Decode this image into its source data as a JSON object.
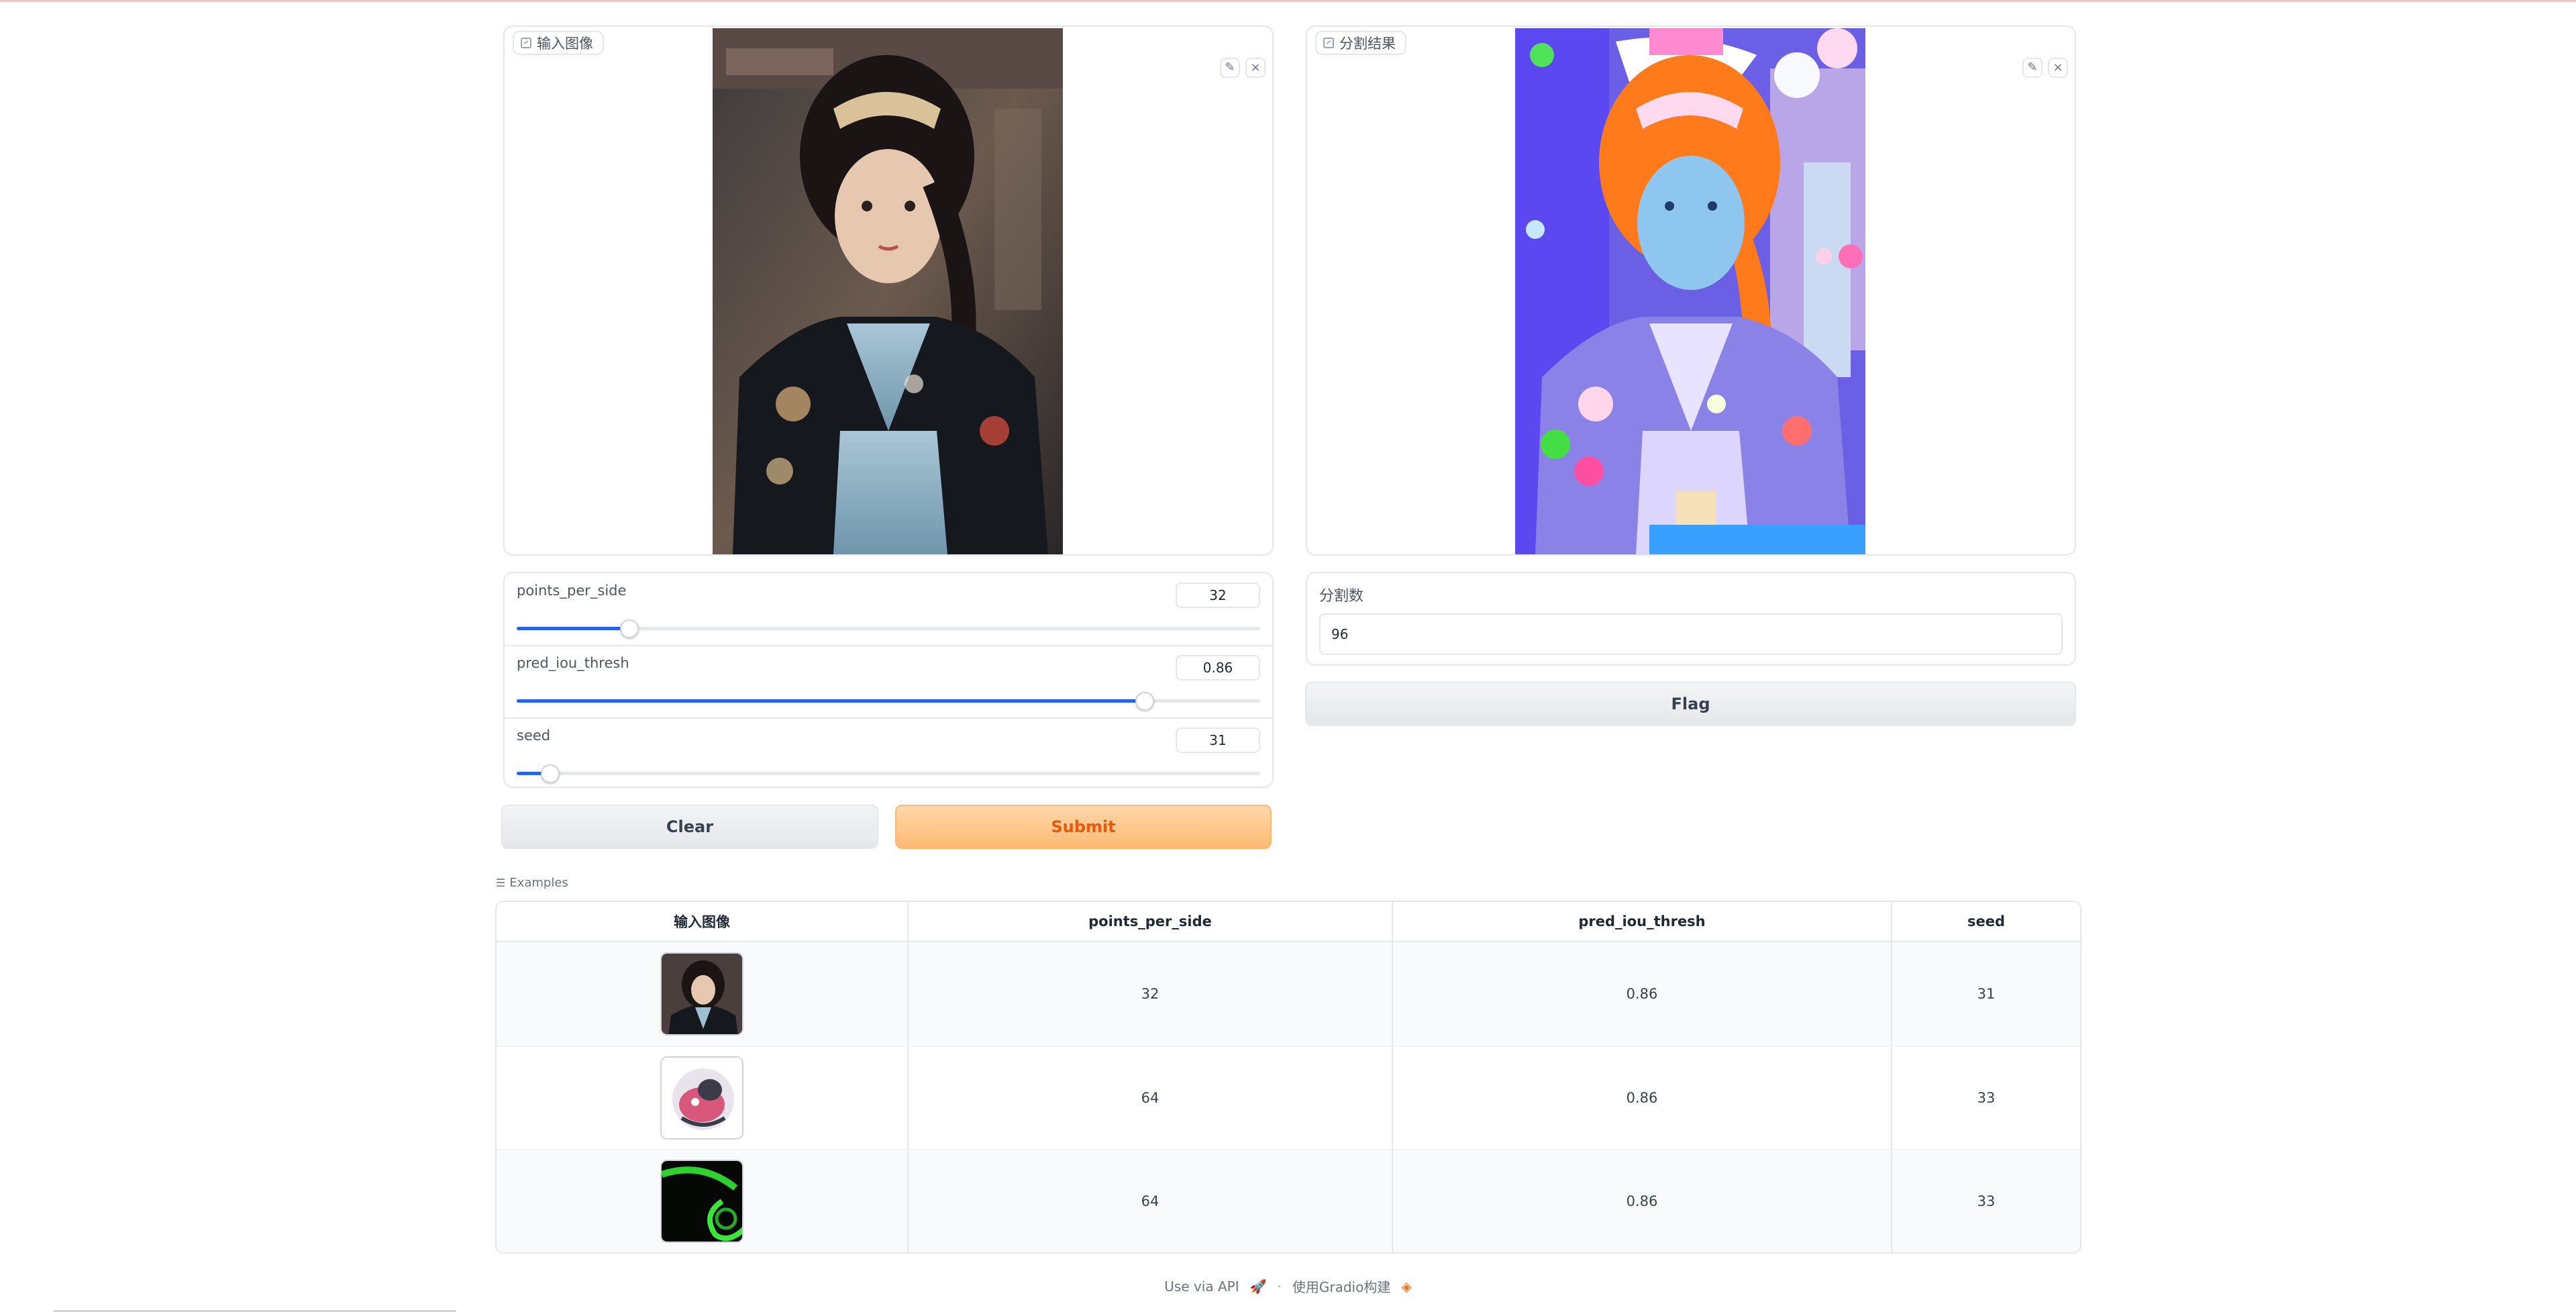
{
  "input_image": {
    "label": "输入图像",
    "edit_icon": "pencil-icon",
    "close_icon": "close-icon"
  },
  "output_image": {
    "label": "分割结果",
    "edit_icon": "pencil-icon",
    "close_icon": "close-icon"
  },
  "sliders": [
    {
      "label": "points_per_side",
      "value": "32",
      "fraction": 0.152
    },
    {
      "label": "pred_iou_thresh",
      "value": "0.86",
      "fraction": 0.845
    },
    {
      "label": "seed",
      "value": "31",
      "fraction": 0.045
    }
  ],
  "buttons": {
    "clear": "Clear",
    "submit": "Submit",
    "flag": "Flag"
  },
  "segment_count": {
    "label": "分割数",
    "value": "96"
  },
  "examples": {
    "label": "Examples",
    "headers": [
      "输入图像",
      "points_per_side",
      "pred_iou_thresh",
      "seed"
    ],
    "rows": [
      {
        "image": "portrait-thumbnail",
        "points_per_side": "32",
        "pred_iou_thresh": "0.86",
        "seed": "31"
      },
      {
        "image": "cartoon-thumbnail",
        "points_per_side": "64",
        "pred_iou_thresh": "0.86",
        "seed": "33"
      },
      {
        "image": "green-neon-thumbnail",
        "points_per_side": "64",
        "pred_iou_thresh": "0.86",
        "seed": "33"
      }
    ]
  },
  "footer": {
    "api": "Use via API",
    "built": "使用Gradio构建",
    "separator": "·"
  },
  "colors": {
    "accent": "#2563eb",
    "submit_bg": "#fdba74",
    "submit_text": "#ea580c"
  }
}
